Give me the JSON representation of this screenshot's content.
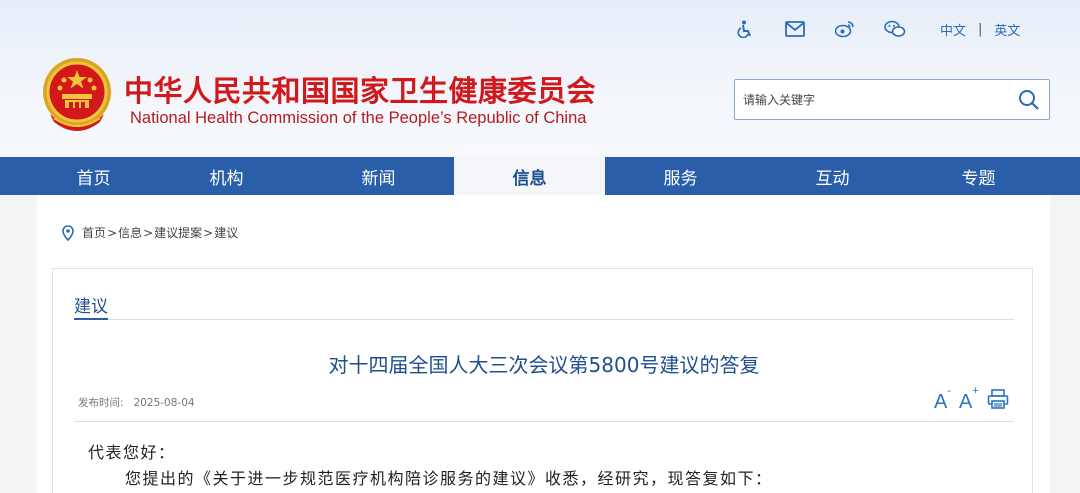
{
  "header": {
    "title_cn": "中华人民共和国国家卫生健康委员会",
    "title_en": "National Health Commission of the People’s Republic of China",
    "icons": [
      "accessibility-icon",
      "mail-icon",
      "weibo-icon",
      "wechat-icon"
    ],
    "lang": {
      "cn": "中文",
      "sep": "|",
      "en": "英文"
    },
    "search": {
      "placeholder": "请输入关键字",
      "value": ""
    }
  },
  "nav": {
    "items": [
      "首页",
      "机构",
      "新闻",
      "信息",
      "服务",
      "互动",
      "专题"
    ],
    "active": "信息"
  },
  "breadcrumb": {
    "items": [
      "首页",
      "信息",
      "建议提案",
      "建议"
    ],
    "separator": ">"
  },
  "section": {
    "title": "建议"
  },
  "article": {
    "title": "对十四届全国人大三次会议第5800号建议的答复",
    "date_label": "发布时间:",
    "date": "2025-08-04",
    "greeting": "代表您好：",
    "para1": "您提出的《关于进一步规范医疗机构陪诊服务的建议》收悉，经研究，现答复如下："
  },
  "tools": {
    "font_decrease": "A",
    "font_increase": "A",
    "minus": "-",
    "plus": "+"
  },
  "colors": {
    "brand_red": "#d0191c",
    "nav_blue": "#2a5ea8",
    "link_blue": "#2b6cb8"
  }
}
